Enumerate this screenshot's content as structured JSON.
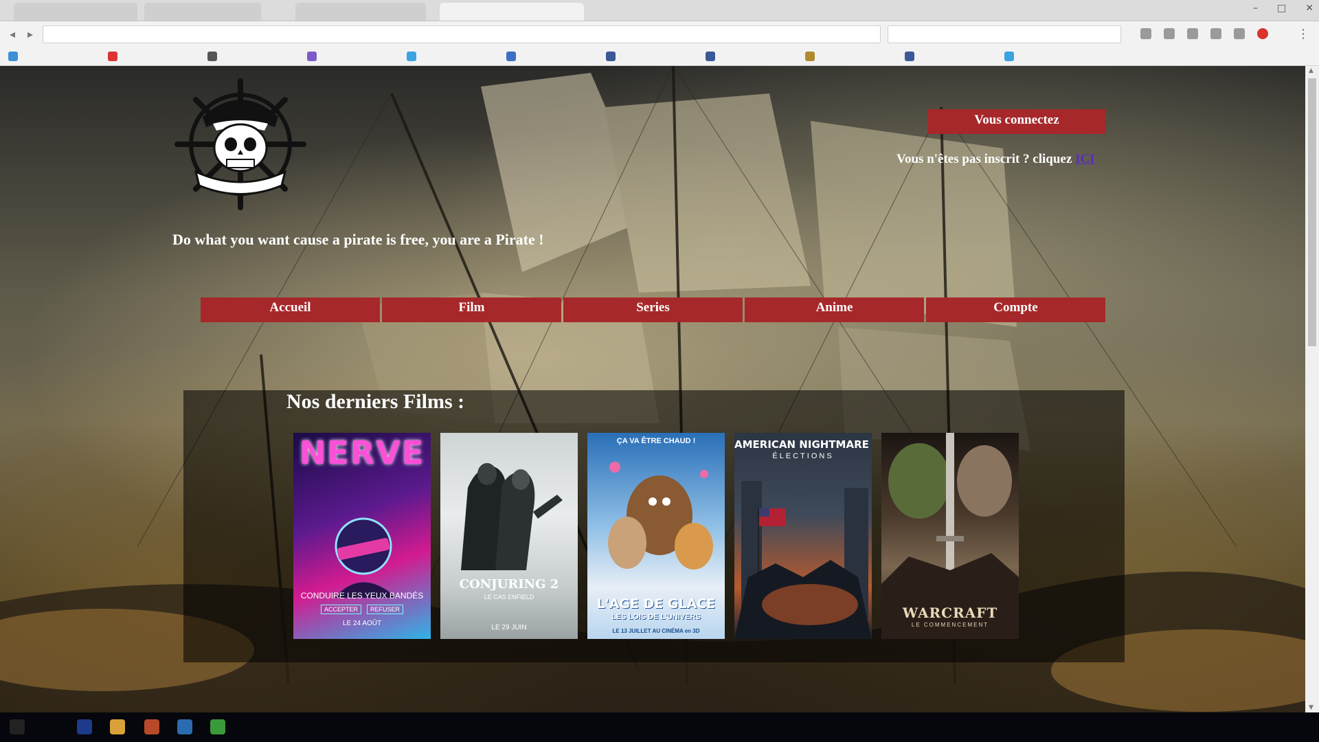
{
  "site": {
    "tagline": "Do what you want cause a pirate is free, you are a Pirate !",
    "login_button": "Vous connectez",
    "register_prompt": "Vous n'êtes pas inscrit ? cliquez",
    "register_link": "ICI"
  },
  "nav": {
    "items": [
      {
        "label": "Accueil"
      },
      {
        "label": "Film"
      },
      {
        "label": "Series"
      },
      {
        "label": "Anime"
      },
      {
        "label": "Compte"
      }
    ]
  },
  "films": {
    "title": "Nos derniers Films :",
    "posters": [
      {
        "title": "NERVE",
        "tagline": "CONDUIRE LES YEUX BANDÉS",
        "date": "LE 24 AOÛT",
        "accept": "ACCEPTER",
        "refuse": "REFUSER",
        "colors": [
          "#2b0f5e",
          "#d21b8f",
          "#2fb4e8"
        ]
      },
      {
        "title": "CONJURING 2",
        "subtitle": "LE CAS ENFIELD",
        "date": "LE 29 JUIN",
        "colors": [
          "#2d3234",
          "#a9b1b2",
          "#e8ecec"
        ]
      },
      {
        "title": "L'AGE DE GLACE",
        "subtitle": "LES LOIS DE L'UNIVERS",
        "tagline": "ÇA VA ÊTRE CHAUD !",
        "date": "LE 13 JUILLET AU CINÉMA en 3D",
        "colors": [
          "#2a6fb8",
          "#c0854a",
          "#e7eef6"
        ]
      },
      {
        "title": "AMERICAN NIGHTMARE 3:",
        "subtitle": "ÉLECTIONS",
        "colors": [
          "#1c2430",
          "#c0572a",
          "#3a4454"
        ]
      },
      {
        "title": "WARCRAFT",
        "subtitle": "LE COMMENCEMENT",
        "colors": [
          "#3a2a1e",
          "#7a6650",
          "#1b1512"
        ]
      }
    ]
  },
  "colors": {
    "accent_red": "#a7282a",
    "link_purple": "#5a2bc4"
  }
}
